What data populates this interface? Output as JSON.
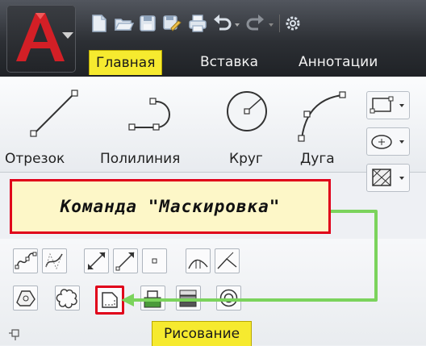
{
  "tabs": [
    "Главная",
    "Вставка",
    "Аннотации"
  ],
  "tools": [
    "Отрезок",
    "Полилиния",
    "Круг",
    "Дуга"
  ],
  "callout": "Команда \"Маскировка\"",
  "panel_title": "Рисование",
  "colors": {
    "accent_tab": "#f6ea2f",
    "highlight_red": "#e0001a",
    "arrow_green": "#7bd35c",
    "callout_bg": "#fdf7c8",
    "logo_red": "#d31f26"
  },
  "icons": [
    "new-icon",
    "open-icon",
    "save-icon",
    "save-as-icon",
    "print-icon",
    "undo-icon",
    "redo-icon",
    "workspace-gear-icon",
    "line-icon",
    "polyline-icon",
    "circle-icon",
    "arc-icon",
    "rectangle-icon",
    "ellipse-icon",
    "hatch-icon",
    "spline-fit-icon",
    "spline-cv-icon",
    "construction-line-icon",
    "ray-icon",
    "point-icon",
    "divide-icon",
    "measure-icon",
    "region-icon",
    "revision-cloud-icon",
    "wipeout-icon",
    "boundary-icon",
    "gradient-icon",
    "donut-icon",
    "pin-icon"
  ]
}
